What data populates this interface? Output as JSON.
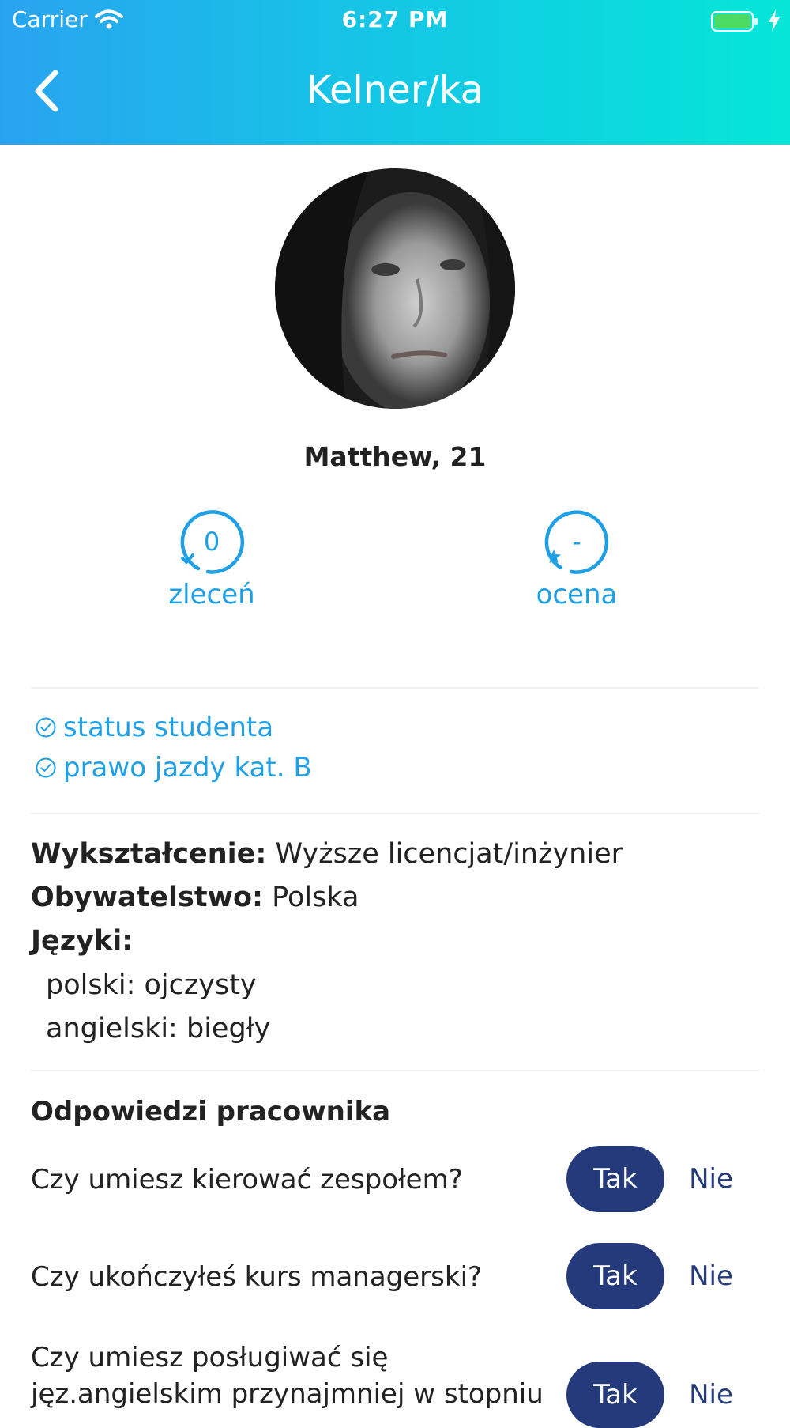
{
  "status_bar": {
    "carrier": "Carrier",
    "time": "6:27 PM"
  },
  "header": {
    "title": "Kelner/ka"
  },
  "profile": {
    "name": "Matthew, 21"
  },
  "stats": [
    {
      "value": "0",
      "label": "zleceń"
    },
    {
      "value": "-",
      "label": "ocena"
    }
  ],
  "badges": [
    "status studenta",
    "prawo jazdy kat. B"
  ],
  "details": {
    "education_label": "Wykształcenie:",
    "education_value": "Wyższe licencjat/inżynier",
    "citizenship_label": "Obywatelstwo:",
    "citizenship_value": "Polska",
    "languages_label": "Języki:",
    "languages": [
      "polski: ojczysty",
      "angielski: biegły"
    ]
  },
  "answers": {
    "title": "Odpowiedzi pracownika",
    "yes_label": "Tak",
    "no_label": "Nie",
    "questions": [
      "Czy umiesz kierować zespołem?",
      "Czy ukończyłeś kurs managerski?",
      "Czy umiesz posługiwać się jęz.angielskim przynajmniej w stopniu"
    ]
  },
  "colors": {
    "accent": "#1fa0e6",
    "button": "#243a7a",
    "header_start": "#29a3f0",
    "header_end": "#05e6d8"
  }
}
